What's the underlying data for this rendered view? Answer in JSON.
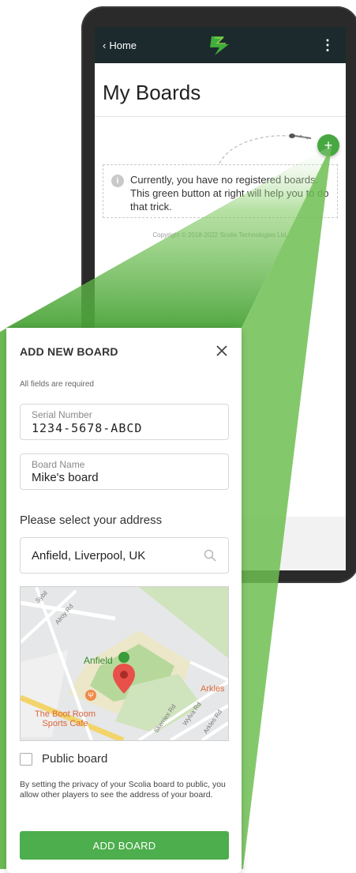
{
  "app": {
    "back_label": "Home",
    "title": "My Boards",
    "empty_message": "Currently, you have no registered boards. This green button at right will help you to do that trick.",
    "copyright": "Copyright © 2018-2022 Scolia Technologies Ltd.",
    "fab_symbol": "+",
    "menu_symbol": "⋮",
    "info_symbol": "i"
  },
  "modal": {
    "title": "ADD NEW BOARD",
    "required_note": "All fields are required",
    "serial": {
      "label": "Serial Number",
      "value": "1234-5678-ABCD"
    },
    "board_name": {
      "label": "Board Name",
      "value": "Mike's board"
    },
    "address_heading": "Please select your address",
    "address": {
      "value": "Anfield, Liverpool, UK"
    },
    "map": {
      "labels": {
        "anfield": "Anfield",
        "arkles": "Arkles",
        "boot_room_line1": "The Boot Room",
        "boot_room_line2": "Sports Cafe",
        "alroy_rd": "Alroy Rd",
        "skerries_rd": "Skerries Rd",
        "wylva_rd": "Wylva Rd",
        "arkles_rd": "Arkles Rd",
        "sybil": "Sybil"
      }
    },
    "public_board_label": "Public board",
    "public_board_checked": false,
    "privacy_text": "By setting the privacy of your Scolia board to public, you allow other players to see the address of your board.",
    "add_button": "ADD BOARD"
  },
  "colors": {
    "accent_green": "#4cae4c",
    "app_bar": "#1c2a2d",
    "phone_frame": "#2a2a2a",
    "pin_red": "#e8504a"
  }
}
